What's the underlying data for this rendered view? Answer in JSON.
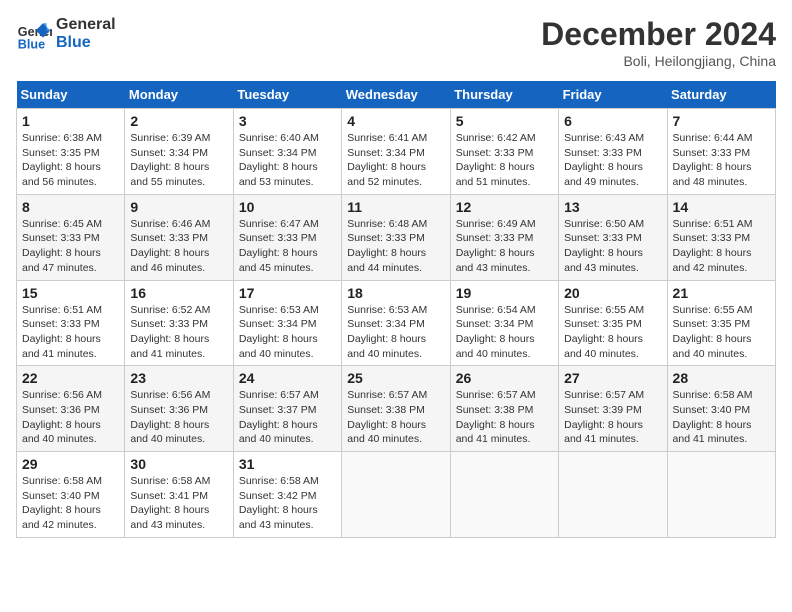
{
  "header": {
    "logo_line1": "General",
    "logo_line2": "Blue",
    "month": "December 2024",
    "location": "Boli, Heilongjiang, China"
  },
  "weekdays": [
    "Sunday",
    "Monday",
    "Tuesday",
    "Wednesday",
    "Thursday",
    "Friday",
    "Saturday"
  ],
  "weeks": [
    [
      {
        "day": "1",
        "sunrise": "Sunrise: 6:38 AM",
        "sunset": "Sunset: 3:35 PM",
        "daylight": "Daylight: 8 hours and 56 minutes."
      },
      {
        "day": "2",
        "sunrise": "Sunrise: 6:39 AM",
        "sunset": "Sunset: 3:34 PM",
        "daylight": "Daylight: 8 hours and 55 minutes."
      },
      {
        "day": "3",
        "sunrise": "Sunrise: 6:40 AM",
        "sunset": "Sunset: 3:34 PM",
        "daylight": "Daylight: 8 hours and 53 minutes."
      },
      {
        "day": "4",
        "sunrise": "Sunrise: 6:41 AM",
        "sunset": "Sunset: 3:34 PM",
        "daylight": "Daylight: 8 hours and 52 minutes."
      },
      {
        "day": "5",
        "sunrise": "Sunrise: 6:42 AM",
        "sunset": "Sunset: 3:33 PM",
        "daylight": "Daylight: 8 hours and 51 minutes."
      },
      {
        "day": "6",
        "sunrise": "Sunrise: 6:43 AM",
        "sunset": "Sunset: 3:33 PM",
        "daylight": "Daylight: 8 hours and 49 minutes."
      },
      {
        "day": "7",
        "sunrise": "Sunrise: 6:44 AM",
        "sunset": "Sunset: 3:33 PM",
        "daylight": "Daylight: 8 hours and 48 minutes."
      }
    ],
    [
      {
        "day": "8",
        "sunrise": "Sunrise: 6:45 AM",
        "sunset": "Sunset: 3:33 PM",
        "daylight": "Daylight: 8 hours and 47 minutes."
      },
      {
        "day": "9",
        "sunrise": "Sunrise: 6:46 AM",
        "sunset": "Sunset: 3:33 PM",
        "daylight": "Daylight: 8 hours and 46 minutes."
      },
      {
        "day": "10",
        "sunrise": "Sunrise: 6:47 AM",
        "sunset": "Sunset: 3:33 PM",
        "daylight": "Daylight: 8 hours and 45 minutes."
      },
      {
        "day": "11",
        "sunrise": "Sunrise: 6:48 AM",
        "sunset": "Sunset: 3:33 PM",
        "daylight": "Daylight: 8 hours and 44 minutes."
      },
      {
        "day": "12",
        "sunrise": "Sunrise: 6:49 AM",
        "sunset": "Sunset: 3:33 PM",
        "daylight": "Daylight: 8 hours and 43 minutes."
      },
      {
        "day": "13",
        "sunrise": "Sunrise: 6:50 AM",
        "sunset": "Sunset: 3:33 PM",
        "daylight": "Daylight: 8 hours and 43 minutes."
      },
      {
        "day": "14",
        "sunrise": "Sunrise: 6:51 AM",
        "sunset": "Sunset: 3:33 PM",
        "daylight": "Daylight: 8 hours and 42 minutes."
      }
    ],
    [
      {
        "day": "15",
        "sunrise": "Sunrise: 6:51 AM",
        "sunset": "Sunset: 3:33 PM",
        "daylight": "Daylight: 8 hours and 41 minutes."
      },
      {
        "day": "16",
        "sunrise": "Sunrise: 6:52 AM",
        "sunset": "Sunset: 3:33 PM",
        "daylight": "Daylight: 8 hours and 41 minutes."
      },
      {
        "day": "17",
        "sunrise": "Sunrise: 6:53 AM",
        "sunset": "Sunset: 3:34 PM",
        "daylight": "Daylight: 8 hours and 40 minutes."
      },
      {
        "day": "18",
        "sunrise": "Sunrise: 6:53 AM",
        "sunset": "Sunset: 3:34 PM",
        "daylight": "Daylight: 8 hours and 40 minutes."
      },
      {
        "day": "19",
        "sunrise": "Sunrise: 6:54 AM",
        "sunset": "Sunset: 3:34 PM",
        "daylight": "Daylight: 8 hours and 40 minutes."
      },
      {
        "day": "20",
        "sunrise": "Sunrise: 6:55 AM",
        "sunset": "Sunset: 3:35 PM",
        "daylight": "Daylight: 8 hours and 40 minutes."
      },
      {
        "day": "21",
        "sunrise": "Sunrise: 6:55 AM",
        "sunset": "Sunset: 3:35 PM",
        "daylight": "Daylight: 8 hours and 40 minutes."
      }
    ],
    [
      {
        "day": "22",
        "sunrise": "Sunrise: 6:56 AM",
        "sunset": "Sunset: 3:36 PM",
        "daylight": "Daylight: 8 hours and 40 minutes."
      },
      {
        "day": "23",
        "sunrise": "Sunrise: 6:56 AM",
        "sunset": "Sunset: 3:36 PM",
        "daylight": "Daylight: 8 hours and 40 minutes."
      },
      {
        "day": "24",
        "sunrise": "Sunrise: 6:57 AM",
        "sunset": "Sunset: 3:37 PM",
        "daylight": "Daylight: 8 hours and 40 minutes."
      },
      {
        "day": "25",
        "sunrise": "Sunrise: 6:57 AM",
        "sunset": "Sunset: 3:38 PM",
        "daylight": "Daylight: 8 hours and 40 minutes."
      },
      {
        "day": "26",
        "sunrise": "Sunrise: 6:57 AM",
        "sunset": "Sunset: 3:38 PM",
        "daylight": "Daylight: 8 hours and 41 minutes."
      },
      {
        "day": "27",
        "sunrise": "Sunrise: 6:57 AM",
        "sunset": "Sunset: 3:39 PM",
        "daylight": "Daylight: 8 hours and 41 minutes."
      },
      {
        "day": "28",
        "sunrise": "Sunrise: 6:58 AM",
        "sunset": "Sunset: 3:40 PM",
        "daylight": "Daylight: 8 hours and 41 minutes."
      }
    ],
    [
      {
        "day": "29",
        "sunrise": "Sunrise: 6:58 AM",
        "sunset": "Sunset: 3:40 PM",
        "daylight": "Daylight: 8 hours and 42 minutes."
      },
      {
        "day": "30",
        "sunrise": "Sunrise: 6:58 AM",
        "sunset": "Sunset: 3:41 PM",
        "daylight": "Daylight: 8 hours and 43 minutes."
      },
      {
        "day": "31",
        "sunrise": "Sunrise: 6:58 AM",
        "sunset": "Sunset: 3:42 PM",
        "daylight": "Daylight: 8 hours and 43 minutes."
      },
      null,
      null,
      null,
      null
    ]
  ]
}
